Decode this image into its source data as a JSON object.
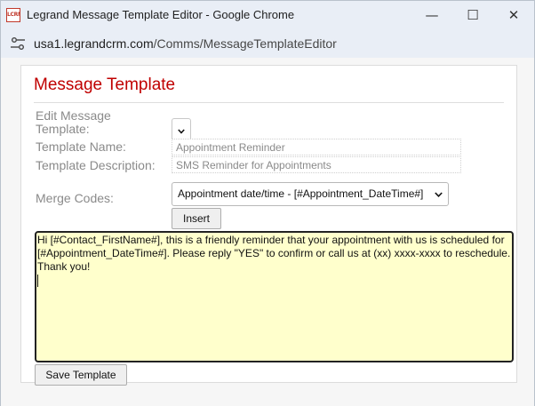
{
  "window": {
    "title": "Legrand Message Template Editor - Google Chrome",
    "icon_text": "LCRM",
    "minimize_glyph": "—",
    "maximize_glyph": "☐",
    "close_glyph": "✕"
  },
  "address": {
    "host": "usa1.legrandcrm.com",
    "path": "/Comms/MessageTemplateEditor"
  },
  "panel": {
    "title": "Message Template"
  },
  "form": {
    "edit_label": "Edit Message Template:",
    "name_label": "Template Name:",
    "name_value": "Appointment Reminder",
    "description_label": "Template Description:",
    "description_value": "SMS Reminder for Appointments",
    "merge_label": "Merge Codes:",
    "merge_selected": "Appointment date/time - [#Appointment_DateTime#]",
    "insert_label": "Insert"
  },
  "message": {
    "body": "Hi [#Contact_FirstName#], this is a friendly reminder that your appointment with us is scheduled for [#Appointment_DateTime#]. Please reply \"YES\" to confirm or call us at (xx) xxxx-xxxx to reschedule. Thank you!"
  },
  "actions": {
    "save_label": "Save Template"
  },
  "colors": {
    "title_red": "#c00000",
    "message_bg": "#ffffcc"
  }
}
